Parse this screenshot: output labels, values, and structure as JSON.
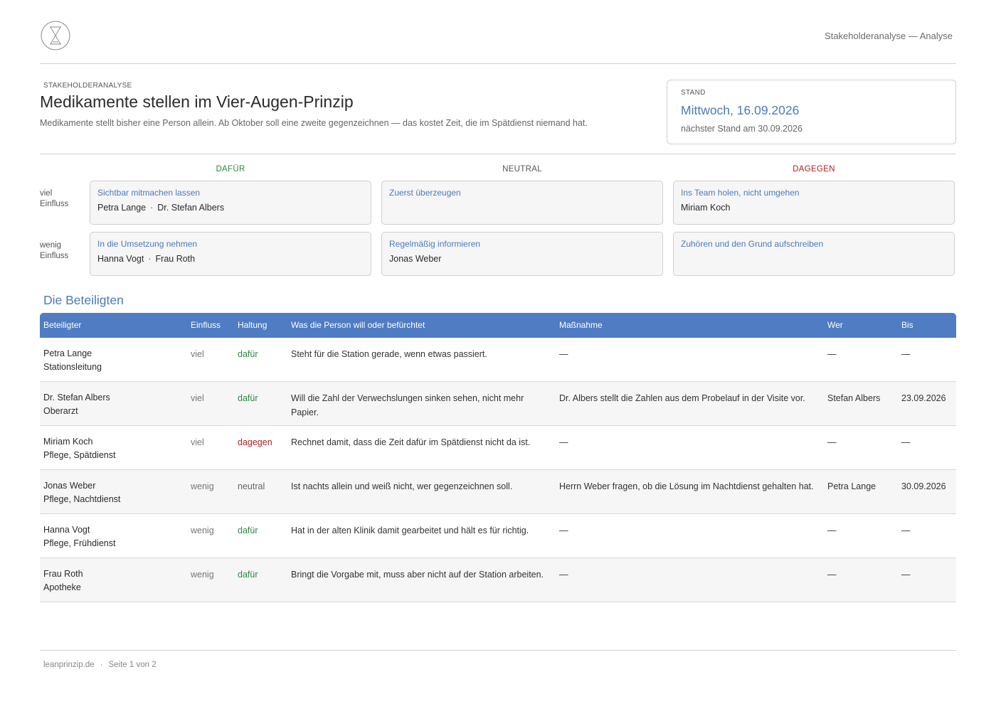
{
  "header": {
    "logo_icon": "hourglass-logo-icon",
    "doc_label": "Stakeholderanalyse — Analyse",
    "eyebrow": "STAKEHOLDERANALYSE",
    "title": "Medikamente stellen im Vier-Augen-Prinzip",
    "subtitle": "Medikamente stellt bisher eine Person allein. Ab Oktober soll eine zweite gegenzeichnen — das kostet Zeit, die im Spätdienst niemand hat."
  },
  "stand": {
    "label": "STAND",
    "date": "Mittwoch, 16.09.2026",
    "next": "nächster Stand am 30.09.2026"
  },
  "matrix": {
    "columns": [
      {
        "label": "DAFÜR",
        "color": "#2d8a3e"
      },
      {
        "label": "NEUTRAL",
        "color": "#555555"
      },
      {
        "label": "DAGEGEN",
        "color": "#b01e1e"
      }
    ],
    "rows": [
      {
        "label_1": "viel",
        "label_2": "Einfluss",
        "cells": [
          {
            "title": "Sichtbar mitmachen lassen",
            "names": [
              "Petra Lange",
              "Dr. Stefan Albers"
            ]
          },
          {
            "title": "Zuerst überzeugen",
            "names": []
          },
          {
            "title": "Ins Team holen, nicht umgehen",
            "names": [
              "Miriam Koch"
            ]
          }
        ]
      },
      {
        "label_1": "wenig",
        "label_2": "Einfluss",
        "cells": [
          {
            "title": "In die Umsetzung nehmen",
            "names": [
              "Hanna Vogt",
              "Frau Roth"
            ]
          },
          {
            "title": "Regelmäßig informieren",
            "names": [
              "Jonas Weber"
            ]
          },
          {
            "title": "Zuhören und den Grund aufschreiben",
            "names": []
          }
        ]
      }
    ],
    "name_separator": "·"
  },
  "table": {
    "section_title": "Die Beteiligten",
    "headers": {
      "beteiligter": "Beteiligter",
      "einfluss": "Einfluss",
      "haltung": "Haltung",
      "was": "Was die Person will oder befürchtet",
      "massnahme": "Maßnahme",
      "wer": "Wer",
      "bis": "Bis"
    },
    "rows": [
      {
        "name": "Petra Lange",
        "role": "Stationsleitung",
        "einfluss": "viel",
        "haltung": "dafür",
        "stance": "dafuer",
        "was": "Steht für die Station gerade, wenn etwas passiert.",
        "massnahme": "—",
        "wer": "—",
        "bis": "—"
      },
      {
        "name": "Dr. Stefan Albers",
        "role": "Oberarzt",
        "einfluss": "viel",
        "haltung": "dafür",
        "stance": "dafuer",
        "was": "Will die Zahl der Verwechslungen sinken sehen, nicht mehr Papier.",
        "massnahme": "Dr. Albers stellt die Zahlen aus dem Probelauf in der Visite vor.",
        "wer": "Stefan Albers",
        "bis": "23.09.2026"
      },
      {
        "name": "Miriam Koch",
        "role": "Pflege, Spätdienst",
        "einfluss": "viel",
        "haltung": "dagegen",
        "stance": "dagegen",
        "was": "Rechnet damit, dass die Zeit dafür im Spätdienst nicht da ist.",
        "massnahme": "—",
        "wer": "—",
        "bis": "—"
      },
      {
        "name": "Jonas Weber",
        "role": "Pflege, Nachtdienst",
        "einfluss": "wenig",
        "haltung": "neutral",
        "stance": "neutral",
        "was": "Ist nachts allein und weiß nicht, wer gegenzeichnen soll.",
        "massnahme": "Herrn Weber fragen, ob die Lösung im Nachtdienst gehalten hat.",
        "wer": "Petra Lange",
        "bis": "30.09.2026"
      },
      {
        "name": "Hanna Vogt",
        "role": "Pflege, Frühdienst",
        "einfluss": "wenig",
        "haltung": "dafür",
        "stance": "dafuer",
        "was": "Hat in der alten Klinik damit gearbeitet und hält es für richtig.",
        "massnahme": "—",
        "wer": "—",
        "bis": "—"
      },
      {
        "name": "Frau Roth",
        "role": "Apotheke",
        "einfluss": "wenig",
        "haltung": "dafür",
        "stance": "dafuer",
        "was": "Bringt die Vorgabe mit, muss aber nicht auf der Station arbeiten.",
        "massnahme": "—",
        "wer": "—",
        "bis": "—"
      }
    ]
  },
  "footer": {
    "site": "leanprinzip.de",
    "separator": "·",
    "page": "Seite 1 von 2"
  },
  "colors": {
    "accent_blue": "#4a7bbe",
    "table_header": "#4f7cc2",
    "dafuer": "#2d8a3e",
    "dagegen": "#b01e1e"
  }
}
